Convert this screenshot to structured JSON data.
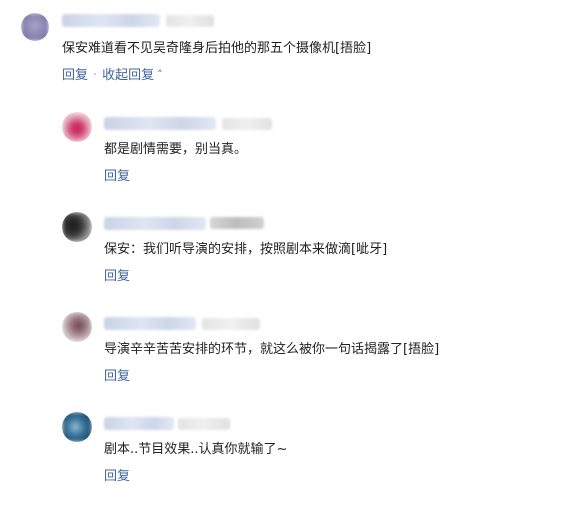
{
  "top_comment": {
    "text": "保安难道看不见吴奇隆身后拍他的那五个摄像机[捂脸]",
    "reply_label": "回复",
    "separator": "·",
    "collapse_label": "收起回复",
    "collapse_icon": "chevron-up-icon"
  },
  "replies": [
    {
      "text": "都是剧情需要，别当真。",
      "reply_label": "回复"
    },
    {
      "text": "保安：我们听导演的安排，按照剧本来做滴[呲牙]",
      "reply_label": "回复"
    },
    {
      "text": "导演辛辛苦苦安排的环节，就这么被你一句话揭露了[捂脸]",
      "reply_label": "回复"
    },
    {
      "text": "剧本..节目效果..认真你就输了~",
      "reply_label": "回复"
    }
  ],
  "colors": {
    "link": "#406599",
    "text": "#222222"
  }
}
